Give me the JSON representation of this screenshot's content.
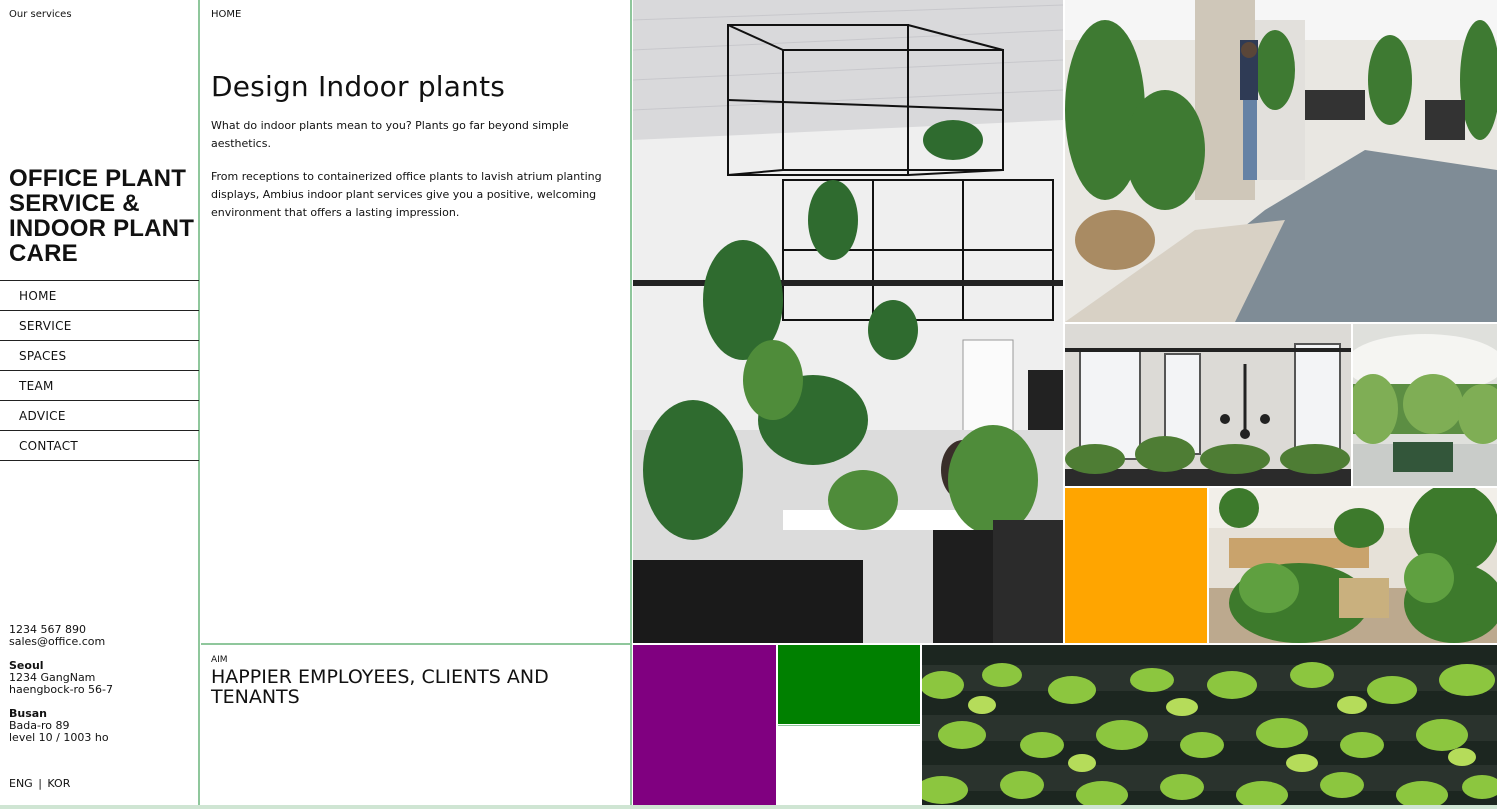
{
  "sidebar": {
    "section_label": "Our services",
    "title": "OFFICE PLANT SERVICE & INDOOR PLANT CARE",
    "nav": [
      "HOME",
      "SERVICE",
      "SPACES",
      "TEAM",
      "ADVICE",
      "CONTACT"
    ],
    "phone": "1234 567 890",
    "email": "sales@office.com",
    "offices": [
      {
        "city": "Seoul",
        "line1": "1234 GangNam",
        "line2": "haengbock-ro 56-7"
      },
      {
        "city": "Busan",
        "line1": "Bada-ro 89",
        "line2": "level 10 / 1003 ho"
      }
    ],
    "languages": [
      "ENG",
      "|",
      "KOR"
    ]
  },
  "main": {
    "breadcrumb": "HOME",
    "title": "Design Indoor plants",
    "paragraph1": "What do indoor plants mean to you? Plants go far beyond simple aesthetics.",
    "paragraph2": "From receptions to containerized office plants to lavish atrium planting displays, Ambius indoor plant services give you a positive, welcoming environment that offers a lasting impression.",
    "aim_label": "AIM",
    "aim_heading": "HAPPIER EMPLOYEES, CLIENTS AND TENANTS"
  },
  "gallery": {
    "colors": {
      "orange": "#FFA500",
      "purple": "#800080",
      "green": "#008000",
      "white": "#FFFFFF",
      "border": "#8FC79C"
    },
    "photos": [
      "office-wire-frame-plants-photo",
      "office-corridor-plants-photo",
      "office-window-planters-photo",
      "hanging-greenery-ceiling-photo",
      "open-office-planters-photo",
      "green-wall-pothos-photo"
    ]
  }
}
